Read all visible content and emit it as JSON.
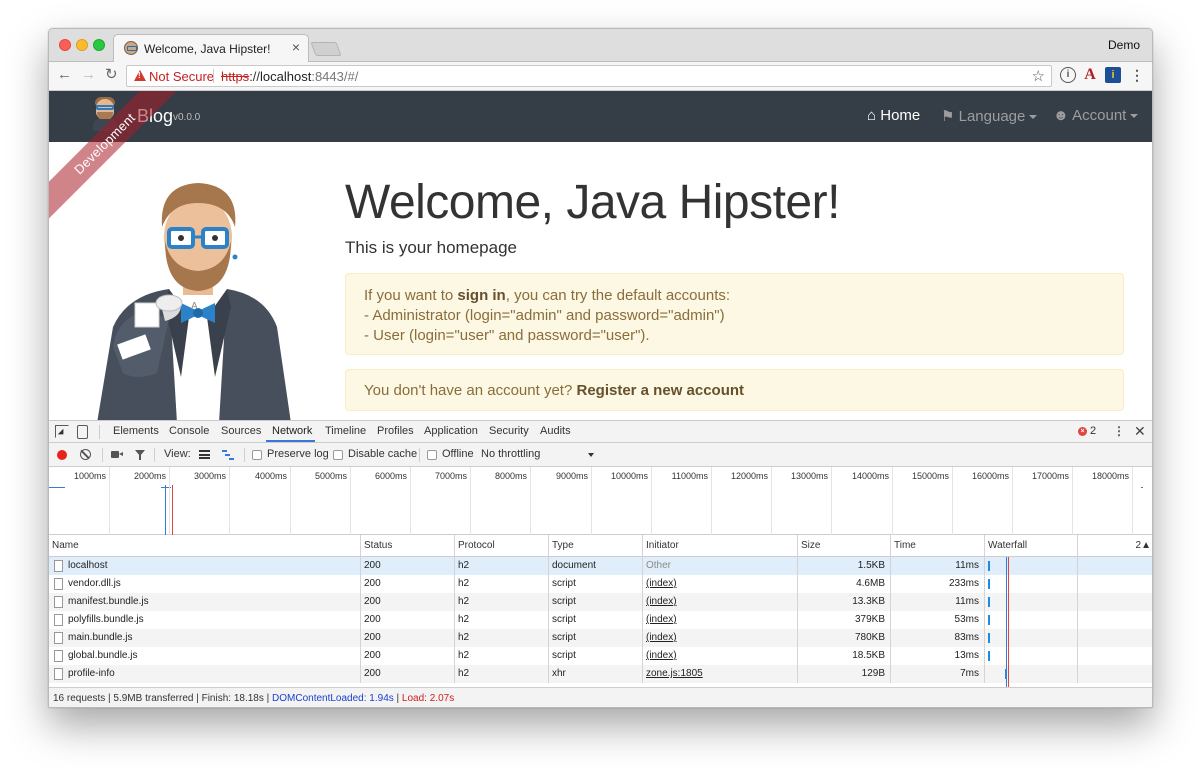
{
  "browser": {
    "tab_title": "Welcome, Java Hipster!",
    "tab_close": "×",
    "profile_name": "Demo",
    "security_label": "Not Secure",
    "url_scheme": "https",
    "url_sep": "://",
    "url_host": "localhost",
    "url_rest": ":8443/#/",
    "nav_back": "←",
    "nav_forward": "→",
    "nav_reload": "↻",
    "bookmark_star": "☆",
    "ext_1": "i",
    "ext_2": "A",
    "ext_3": "i",
    "menu": "⋮"
  },
  "app": {
    "brand": "Blog",
    "version": "v0.0.0",
    "ribbon": "Development",
    "nav": {
      "home": "Home",
      "language": "Language",
      "account": "Account"
    },
    "nav_icons": {
      "home": "⌂",
      "language": "⚑",
      "account": "☻"
    }
  },
  "hero": {
    "title": "Welcome, Java Hipster!",
    "lead": "This is your homepage",
    "signin_prefix": "If you want to ",
    "signin_strong": "sign in",
    "signin_suffix": ", you can try the default accounts:",
    "admin_line": "- Administrator (login=\"admin\" and password=\"admin\")",
    "user_line": "- User (login=\"user\" and password=\"user\").",
    "register_prefix": "You don't have an account yet? ",
    "register_link": "Register a new account"
  },
  "devtools": {
    "tabs": [
      "Elements",
      "Console",
      "Sources",
      "Network",
      "Timeline",
      "Profiles",
      "Application",
      "Security",
      "Audits"
    ],
    "active_tab": "Network",
    "error_count": "2",
    "error_icon": "×",
    "kebab": "⋮",
    "close": "✕",
    "toolbar": {
      "view_label": "View:",
      "preserve_log": "Preserve log",
      "disable_cache": "Disable cache",
      "offline": "Offline",
      "throttling": "No throttling"
    },
    "timeline_ticks": [
      "1000ms",
      "2000ms",
      "3000ms",
      "4000ms",
      "5000ms",
      "6000ms",
      "7000ms",
      "8000ms",
      "9000ms",
      "10000ms",
      "11000ms",
      "12000ms",
      "13000ms",
      "14000ms",
      "15000ms",
      "16000ms",
      "17000ms",
      "18000ms"
    ],
    "columns": {
      "name": "Name",
      "status": "Status",
      "protocol": "Protocol",
      "type": "Type",
      "initiator": "Initiator",
      "size": "Size",
      "time": "Time",
      "waterfall": "Waterfall",
      "sort_indicator": "2▲"
    },
    "rows": [
      {
        "name": "localhost",
        "status": "200",
        "protocol": "h2",
        "type": "document",
        "initiator": "Other",
        "size": "1.5KB",
        "time": "11ms"
      },
      {
        "name": "vendor.dll.js",
        "status": "200",
        "protocol": "h2",
        "type": "script",
        "initiator": "(index)",
        "size": "4.6MB",
        "time": "233ms"
      },
      {
        "name": "manifest.bundle.js",
        "status": "200",
        "protocol": "h2",
        "type": "script",
        "initiator": "(index)",
        "size": "13.3KB",
        "time": "11ms"
      },
      {
        "name": "polyfills.bundle.js",
        "status": "200",
        "protocol": "h2",
        "type": "script",
        "initiator": "(index)",
        "size": "379KB",
        "time": "53ms"
      },
      {
        "name": "main.bundle.js",
        "status": "200",
        "protocol": "h2",
        "type": "script",
        "initiator": "(index)",
        "size": "780KB",
        "time": "83ms"
      },
      {
        "name": "global.bundle.js",
        "status": "200",
        "protocol": "h2",
        "type": "script",
        "initiator": "(index)",
        "size": "18.5KB",
        "time": "13ms"
      },
      {
        "name": "profile-info",
        "status": "200",
        "protocol": "h2",
        "type": "xhr",
        "initiator": "zone.js:1805",
        "size": "129B",
        "time": "7ms"
      }
    ],
    "summary": {
      "main": "16 requests | 5.9MB transferred | Finish: 18.18s | ",
      "dom_loaded": "DOMContentLoaded: 1.94s",
      "divider": " | ",
      "load": "Load: 2.07s"
    },
    "colors": {
      "dom_loaded": "#1a3fcf",
      "load": "#cf1d1d",
      "accent": "#3879d9"
    }
  }
}
